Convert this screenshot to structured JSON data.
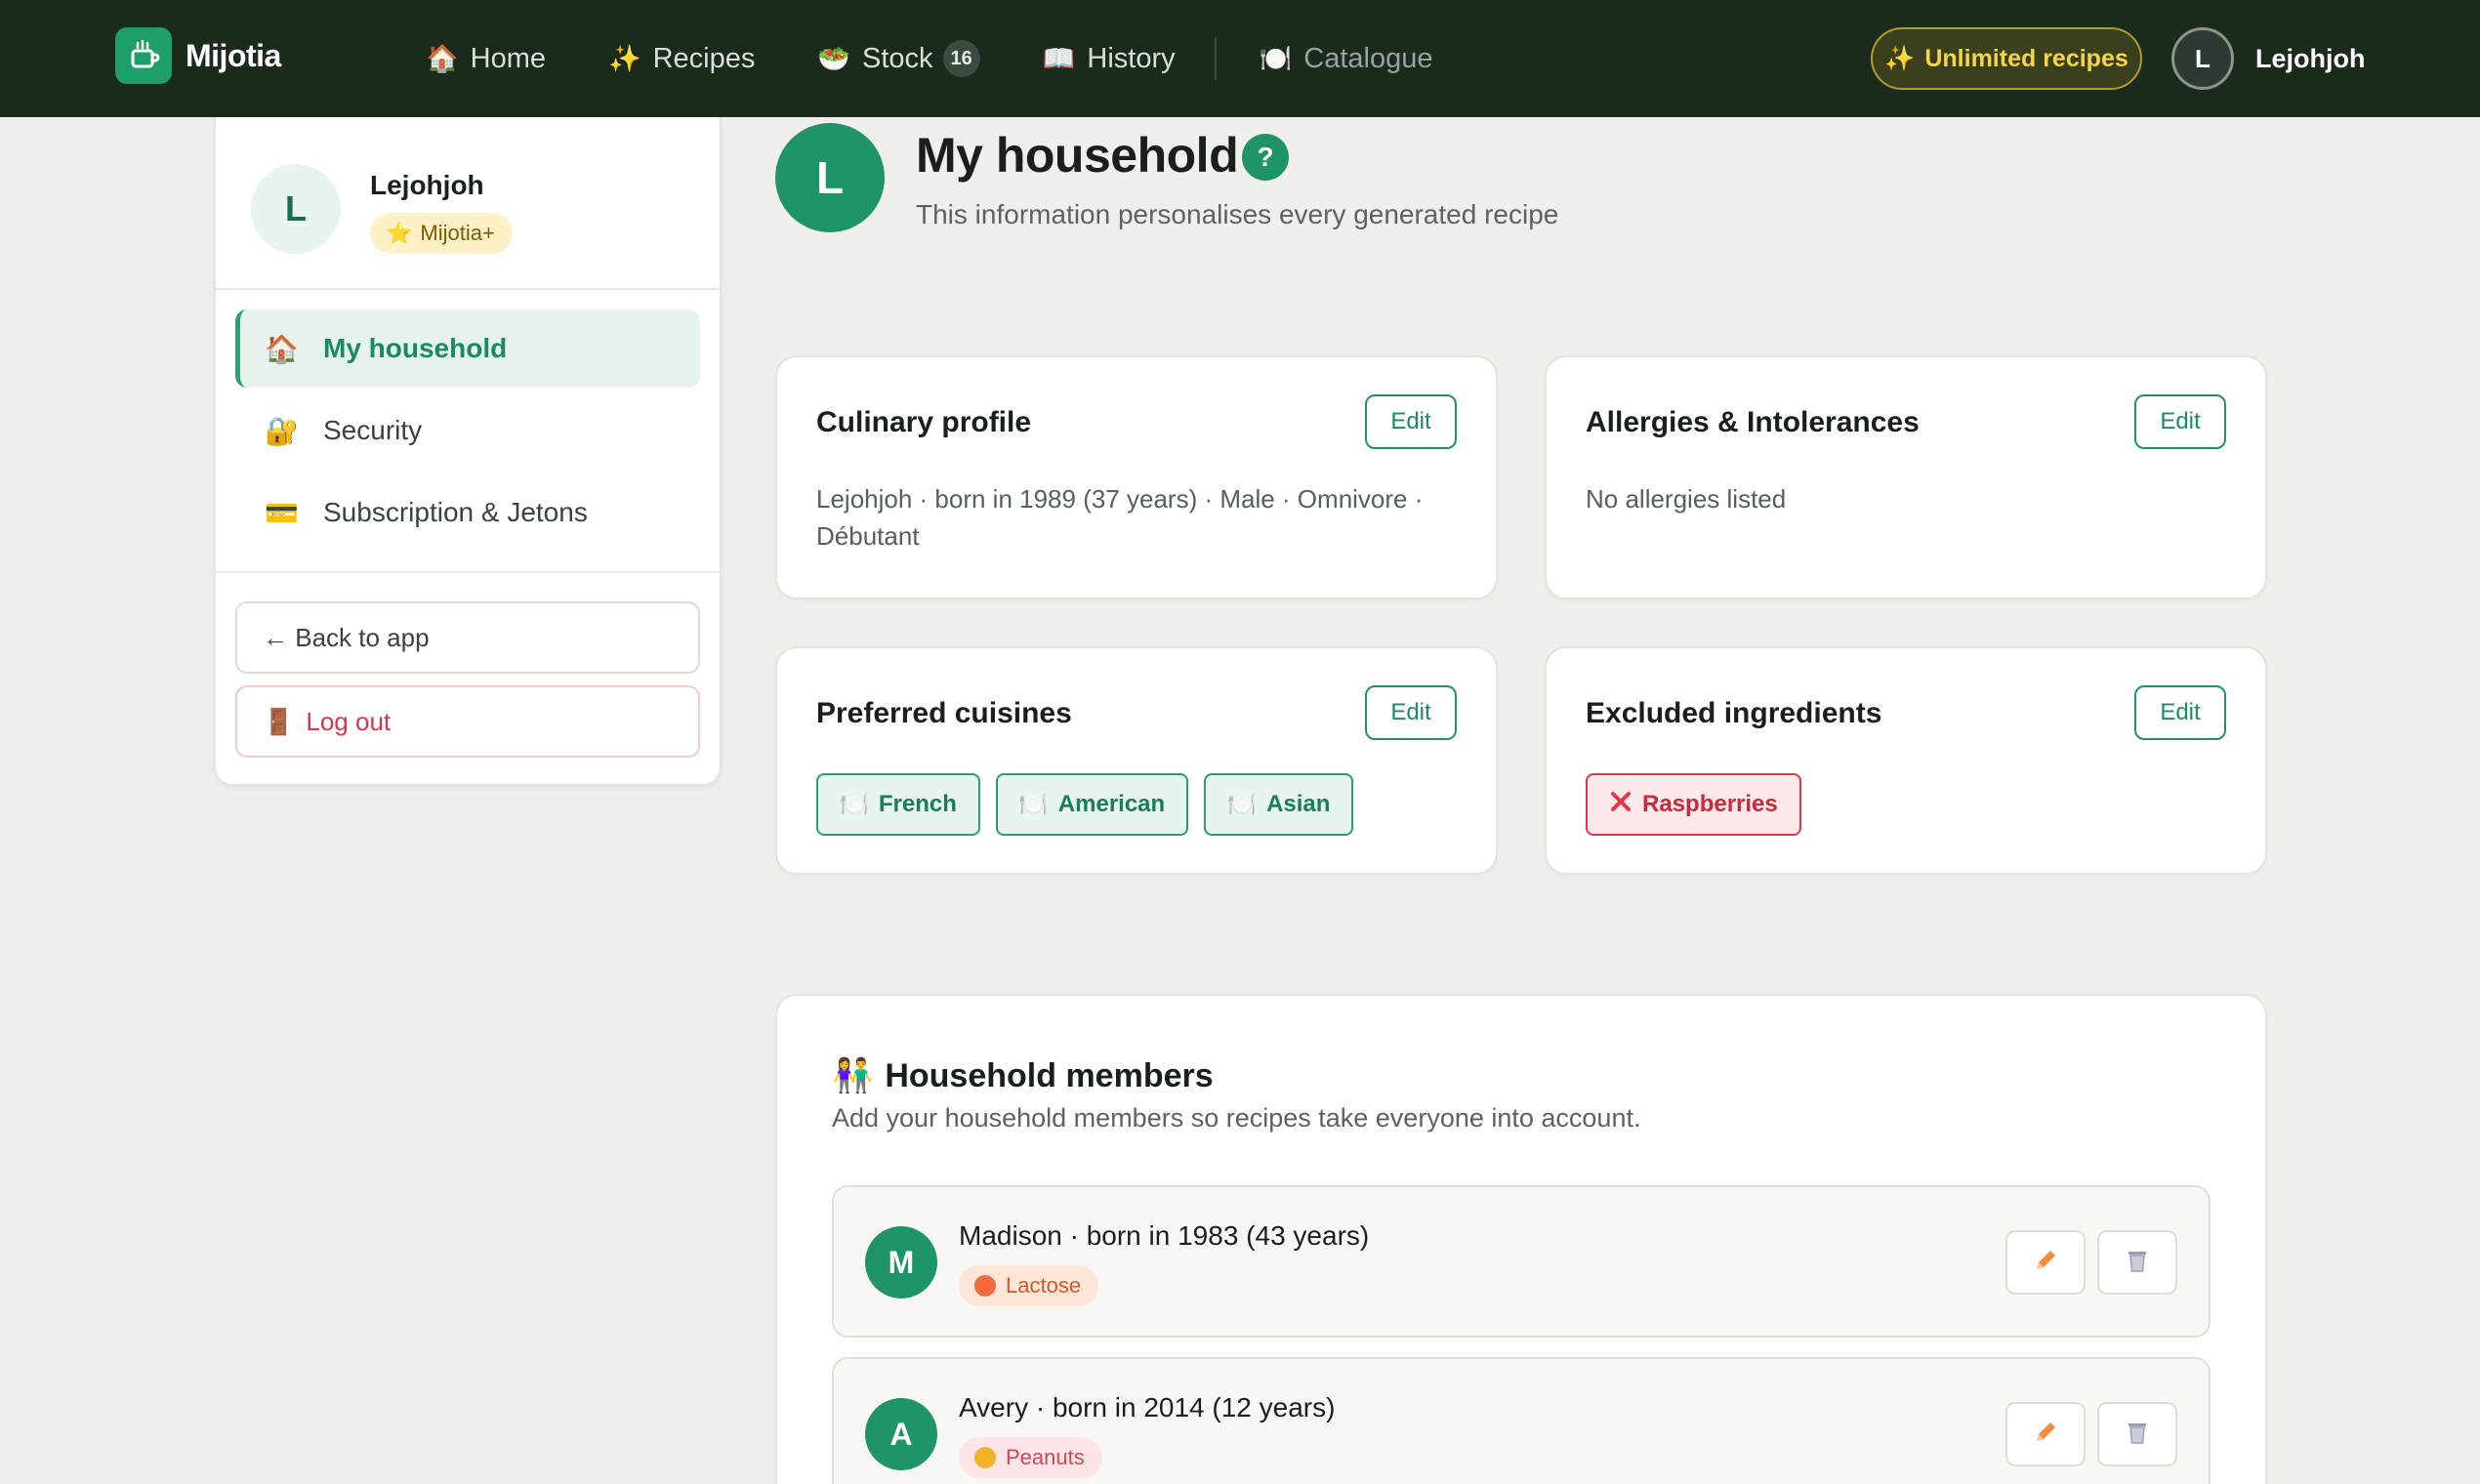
{
  "nav": {
    "brand": "Mijotia",
    "links": [
      {
        "label": "Home",
        "icon": "house-icon",
        "glyph": "🏠"
      },
      {
        "label": "Recipes",
        "icon": "sparkles-icon",
        "glyph": "✨"
      },
      {
        "label": "Stock",
        "icon": "salad-bowl-icon",
        "glyph": "🥗",
        "badge": "16"
      },
      {
        "label": "History",
        "icon": "book-icon",
        "glyph": "📖"
      },
      {
        "label": "Catalogue",
        "icon": "plate-icon",
        "glyph": "🍽️"
      }
    ],
    "upgrade_label": "Unlimited recipes",
    "user_initial": "L",
    "username": "Lejohjoh"
  },
  "sidebar": {
    "avatar_initial": "L",
    "name": "Lejohjoh",
    "plan": "Mijotia+",
    "items": [
      {
        "label": "My household",
        "glyph": "🏠"
      },
      {
        "label": "Security",
        "glyph": "🔐"
      },
      {
        "label": "Subscription & Jetons",
        "glyph": "💳"
      }
    ],
    "back_label": "← Back to app",
    "logout_label": "Log out"
  },
  "header": {
    "avatar_initial": "L",
    "title": "My household",
    "help": "?",
    "subtitle": "This information personalises every generated recipe"
  },
  "cards": {
    "edit_label": "Edit",
    "culinary": {
      "title": "Culinary profile",
      "text": "Lejohjoh · born in 1989 (37 years) · Male · Omnivore · Débutant"
    },
    "allergies": {
      "title": "Allergies & Intolerances",
      "text": "No allergies listed"
    },
    "cuisines": {
      "title": "Preferred cuisines",
      "items": [
        "French",
        "American",
        "Asian"
      ]
    },
    "excluded": {
      "title": "Excluded ingredients",
      "items": [
        "Raspberries"
      ]
    }
  },
  "members": {
    "title": "Household members",
    "subtitle": "Add your household members so recipes take everyone into account.",
    "list": [
      {
        "initial": "M",
        "label": "Madison · born in 1983 (43 years)",
        "tag": "Lactose"
      },
      {
        "initial": "A",
        "label": "Avery · born in 2014 (12 years)",
        "tag": "Peanuts"
      }
    ]
  },
  "colors": {
    "nav_bg": "#1a2a1c",
    "accent": "#1e9467",
    "danger": "#d43848",
    "gold": "#f7d447"
  }
}
